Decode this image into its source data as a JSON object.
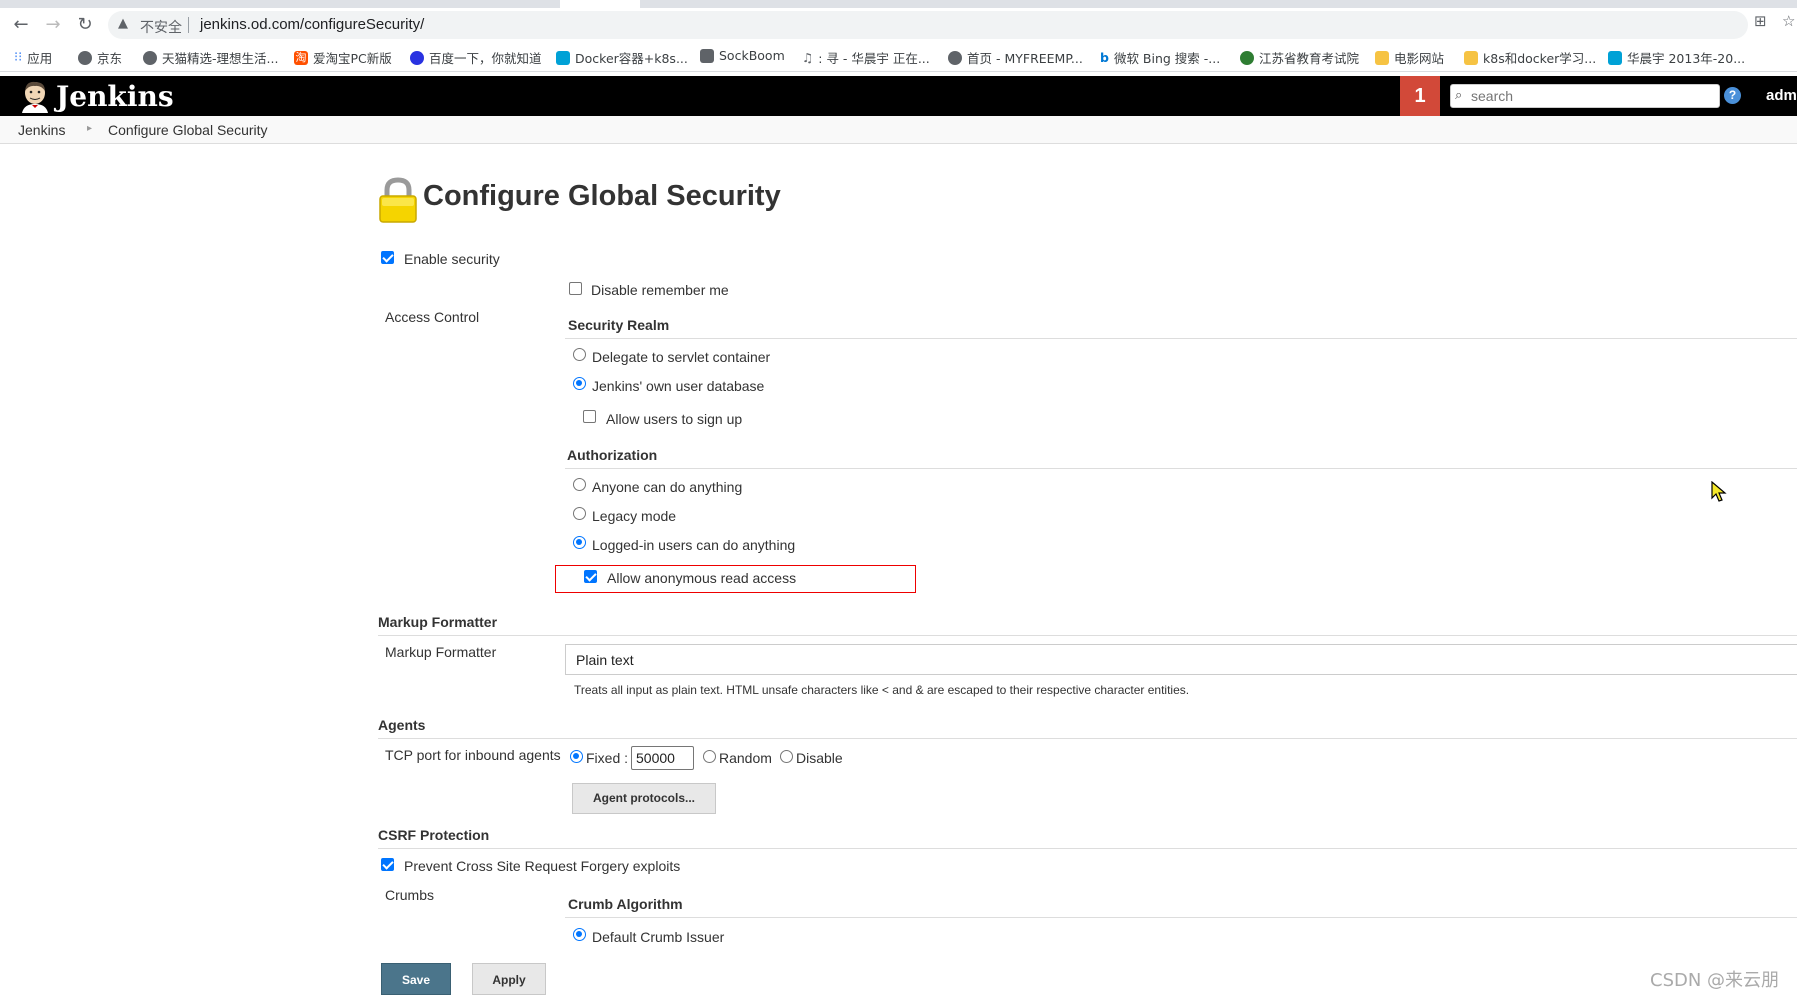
{
  "browser": {
    "security_label": "不安全",
    "url": "jenkins.od.com/configureSecurity/",
    "bookmarks": [
      {
        "label": "应用",
        "color": "#4285f4"
      },
      {
        "label": "京东",
        "color": "#5f6368"
      },
      {
        "label": "天猫精选-理想生活...",
        "color": "#5f6368"
      },
      {
        "label": "爱淘宝PC新版",
        "color": "#ff5000"
      },
      {
        "label": "百度一下，你就知道",
        "color": "#2932e1"
      },
      {
        "label": "Docker容器+k8s...",
        "color": "#00a1d6"
      },
      {
        "label": "SockBoom",
        "color": "#5f6368"
      },
      {
        "label": ": 寻 - 华晨宇 正在...",
        "color": "#5f6368"
      },
      {
        "label": "首页 - MYFREEMP...",
        "color": "#5f6368"
      },
      {
        "label": "微软 Bing 搜索 -...",
        "color": "#0078d4"
      },
      {
        "label": "江苏省教育考试院",
        "color": "#2e7d32"
      },
      {
        "label": "电影网站",
        "color": "#f6c343"
      },
      {
        "label": "k8s和docker学习...",
        "color": "#f6c343"
      },
      {
        "label": "华晨宇 2013年-20...",
        "color": "#00a1d6"
      }
    ]
  },
  "header": {
    "app_name": "Jenkins",
    "notification_count": "1",
    "search_placeholder": "search",
    "help_glyph": "?",
    "user": "admi"
  },
  "breadcrumb": {
    "items": [
      "Jenkins",
      "Configure Global Security"
    ]
  },
  "page": {
    "title": "Configure Global Security",
    "enable_security": {
      "label": "Enable security",
      "checked": true
    },
    "access_control_label": "Access Control",
    "disable_remember_me": {
      "label": "Disable remember me",
      "checked": false
    },
    "security_realm": {
      "heading": "Security Realm",
      "options": [
        {
          "label": "Delegate to servlet container",
          "selected": false
        },
        {
          "label": "Jenkins' own user database",
          "selected": true
        }
      ],
      "allow_signup": {
        "label": "Allow users to sign up",
        "checked": false
      }
    },
    "authorization": {
      "heading": "Authorization",
      "options": [
        {
          "label": "Anyone can do anything",
          "selected": false
        },
        {
          "label": "Legacy mode",
          "selected": false
        },
        {
          "label": "Logged-in users can do anything",
          "selected": true
        }
      ],
      "allow_anonymous_read": {
        "label": "Allow anonymous read access",
        "checked": true
      }
    },
    "markup_formatter": {
      "heading": "Markup Formatter",
      "label": "Markup Formatter",
      "value": "Plain text",
      "help": "Treats all input as plain text. HTML unsafe characters like < and & are escaped to their respective character entities."
    },
    "agents": {
      "heading": "Agents",
      "port_label": "TCP port for inbound agents",
      "fixed_label": "Fixed :",
      "port_value": "50000",
      "random_label": "Random",
      "disable_label": "Disable",
      "protocols_button": "Agent protocols..."
    },
    "csrf": {
      "heading": "CSRF Protection",
      "prevent": {
        "label": "Prevent Cross Site Request Forgery exploits",
        "checked": true
      },
      "crumbs_label": "Crumbs",
      "crumb_algorithm_heading": "Crumb Algorithm",
      "default_issuer": {
        "label": "Default Crumb Issuer",
        "selected": true
      }
    },
    "buttons": {
      "save": "Save",
      "apply": "Apply"
    }
  },
  "watermark": "CSDN @来云朋",
  "colors": {
    "jenkins_header": "#000000",
    "badge": "#d24939",
    "save_button": "#4b758b",
    "highlight": "#ee0000",
    "accent": "#0075ff"
  }
}
